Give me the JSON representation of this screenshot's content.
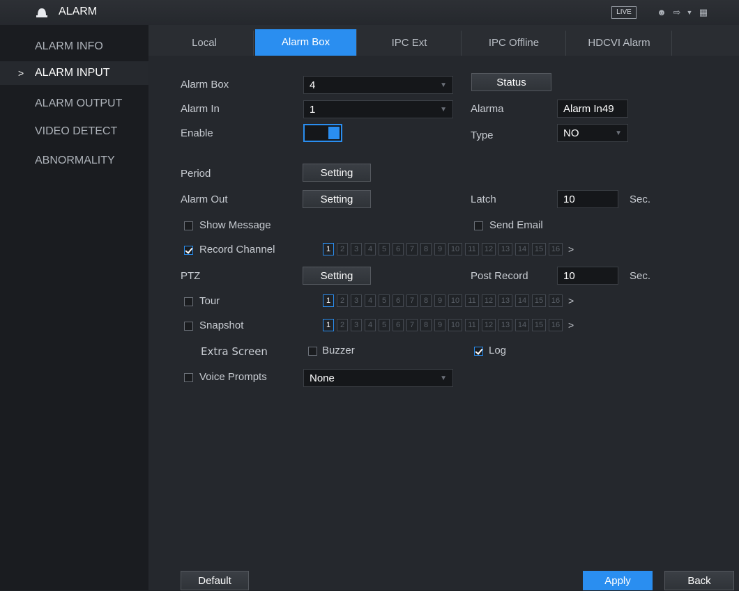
{
  "titlebar": {
    "title": "ALARM",
    "live_label": "LIVE"
  },
  "sidebar": {
    "items": [
      {
        "label": "ALARM INFO",
        "active": false
      },
      {
        "label": "ALARM INPUT",
        "active": true
      },
      {
        "label": "ALARM OUTPUT",
        "active": false
      },
      {
        "label": "VIDEO DETECT",
        "active": false
      },
      {
        "label": "ABNORMALITY",
        "active": false
      }
    ],
    "caret": ">"
  },
  "tabs": [
    "Local",
    "Alarm Box",
    "IPC Ext",
    "IPC Offline",
    "HDCVI Alarm"
  ],
  "active_tab": "Alarm Box",
  "form": {
    "alarm_box_label": "Alarm Box",
    "alarm_box_value": "4",
    "status_button": "Status",
    "alarm_in_label": "Alarm In",
    "alarm_in_value": "1",
    "alarma_label": "Alarma",
    "alarma_value": "Alarm In49",
    "enable_label": "Enable",
    "enable_on": true,
    "type_label": "Type",
    "type_value": "NO",
    "period_label": "Period",
    "period_button": "Setting",
    "alarm_out_label": "Alarm Out",
    "alarm_out_button": "Setting",
    "latch_label": "Latch",
    "latch_value": "10",
    "latch_unit": "Sec.",
    "show_message_label": "Show Message",
    "show_message_checked": false,
    "send_email_label": "Send Email",
    "send_email_checked": false,
    "record_channel_label": "Record Channel",
    "record_channel_checked": true,
    "ptz_label": "PTZ",
    "ptz_button": "Setting",
    "post_record_label": "Post Record",
    "post_record_value": "10",
    "post_record_unit": "Sec.",
    "tour_label": "Tour",
    "tour_checked": false,
    "snapshot_label": "Snapshot",
    "snapshot_checked": false,
    "extra_screen_label": "Extra Screen",
    "buzzer_label": "Buzzer",
    "buzzer_checked": false,
    "log_label": "Log",
    "log_checked": true,
    "voice_prompts_label": "Voice Prompts",
    "voice_prompts_checked": false,
    "voice_prompts_value": "None"
  },
  "channels": [
    "1",
    "2",
    "3",
    "4",
    "5",
    "6",
    "7",
    "8",
    "9",
    "10",
    "11",
    "12",
    "13",
    "14",
    "15",
    "16"
  ],
  "channel_selected": "1",
  "next_arrow": ">",
  "footer": {
    "default_button": "Default",
    "apply_button": "Apply",
    "back_button": "Back"
  },
  "colors": {
    "accent": "#2a8ef0",
    "background": "#25282d",
    "sidebar": "#1a1c20"
  }
}
